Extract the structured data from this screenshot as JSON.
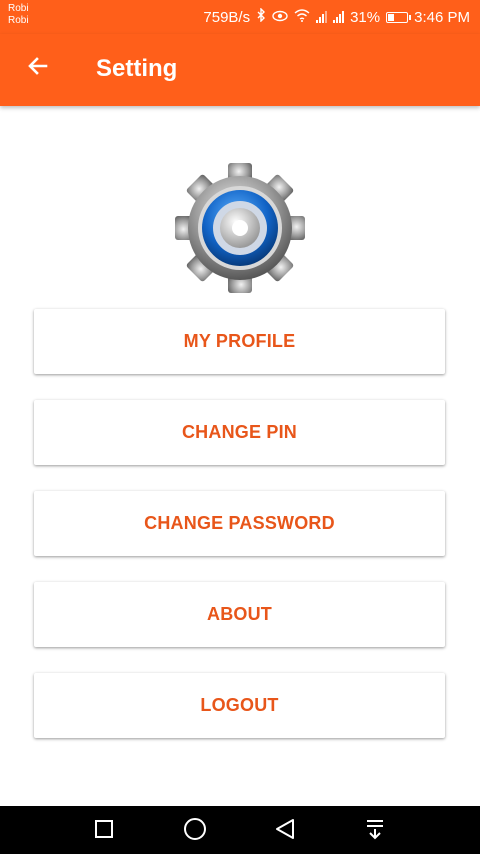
{
  "status_bar": {
    "carrier_line1": "Robi",
    "carrier_line2": "Robi",
    "network_speed": "759B/s",
    "battery": "31%",
    "battery_level": 0.31,
    "time": "3:46 PM",
    "icons": [
      "bluetooth-icon",
      "eye-icon",
      "wifi-icon",
      "signal-icon",
      "signal-icon",
      "battery-icon"
    ]
  },
  "app_bar": {
    "title": "Setting",
    "back_icon": "arrow-left-icon",
    "color": "#ff5f1a"
  },
  "logo": {
    "icon": "settings-gear-icon"
  },
  "menu": {
    "text_color": "#e8561a",
    "items": [
      {
        "label": "MY PROFILE"
      },
      {
        "label": "CHANGE PIN"
      },
      {
        "label": "CHANGE PASSWORD"
      },
      {
        "label": "ABOUT"
      },
      {
        "label": "LOGOUT"
      }
    ]
  },
  "nav_bar": {
    "icons": [
      "recent-apps-icon",
      "home-icon",
      "back-icon",
      "notification-shade-icon"
    ]
  }
}
